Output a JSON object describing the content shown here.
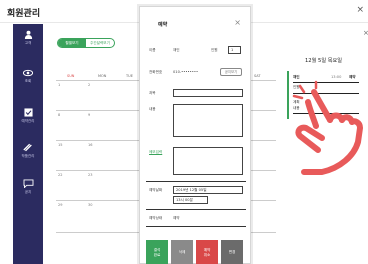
{
  "app": {
    "title": "회원관리"
  },
  "sidebar": {
    "items": [
      {
        "icon": "user-icon",
        "label": "고객"
      },
      {
        "icon": "eye-icon",
        "label": "조회"
      },
      {
        "icon": "checkbox-icon",
        "label": "예약관리"
      },
      {
        "icon": "pencil-icon",
        "label": "작품관리"
      },
      {
        "icon": "chat-icon",
        "label": "공지"
      }
    ]
  },
  "calendar": {
    "toggle": [
      "월별보기",
      "주간달력보기"
    ],
    "weekdays": [
      "SUN",
      "MON",
      "TUE",
      "WED",
      "THU",
      "FRI",
      "SAT"
    ],
    "days": [
      "1",
      "2",
      "8",
      "9",
      "15",
      "16",
      "22",
      "23",
      "29",
      "30"
    ]
  },
  "modal": {
    "title": "예약",
    "close": "×",
    "name_label": "이름",
    "name_value": "재인",
    "people_label": "인원",
    "people_value": "1",
    "phone_label": "전화번호",
    "phone_value": "010-••••••••",
    "phone_button": "공지보기",
    "course_label": "과목",
    "content_label": "내용",
    "memo_link": "메모입력",
    "date_label": "예약날짜",
    "date_value": "2019년 12월 05일",
    "time_value": "13시 00분",
    "status_label": "예약상태",
    "status_value": "예약",
    "buttons": {
      "complete": "결석\n완료",
      "delete": "삭제",
      "cancel": "예약\n취소",
      "change": "변경"
    }
  },
  "right_panel": {
    "date": "12월 5일 목요일",
    "close": "×",
    "row1": {
      "name": "재인",
      "time": "13:00",
      "status": "예약"
    },
    "row2_label": "인원",
    "row3_label": "계획",
    "row4_label": "내용"
  },
  "colors": {
    "sidebar": "#2b2b60",
    "accent": "#3aa35b",
    "btn_green": "#3aa35b",
    "btn_gray": "#8a8a8a",
    "btn_red": "#d94848",
    "btn_dark": "#6b6b6b",
    "hand": "#e85a5a"
  }
}
